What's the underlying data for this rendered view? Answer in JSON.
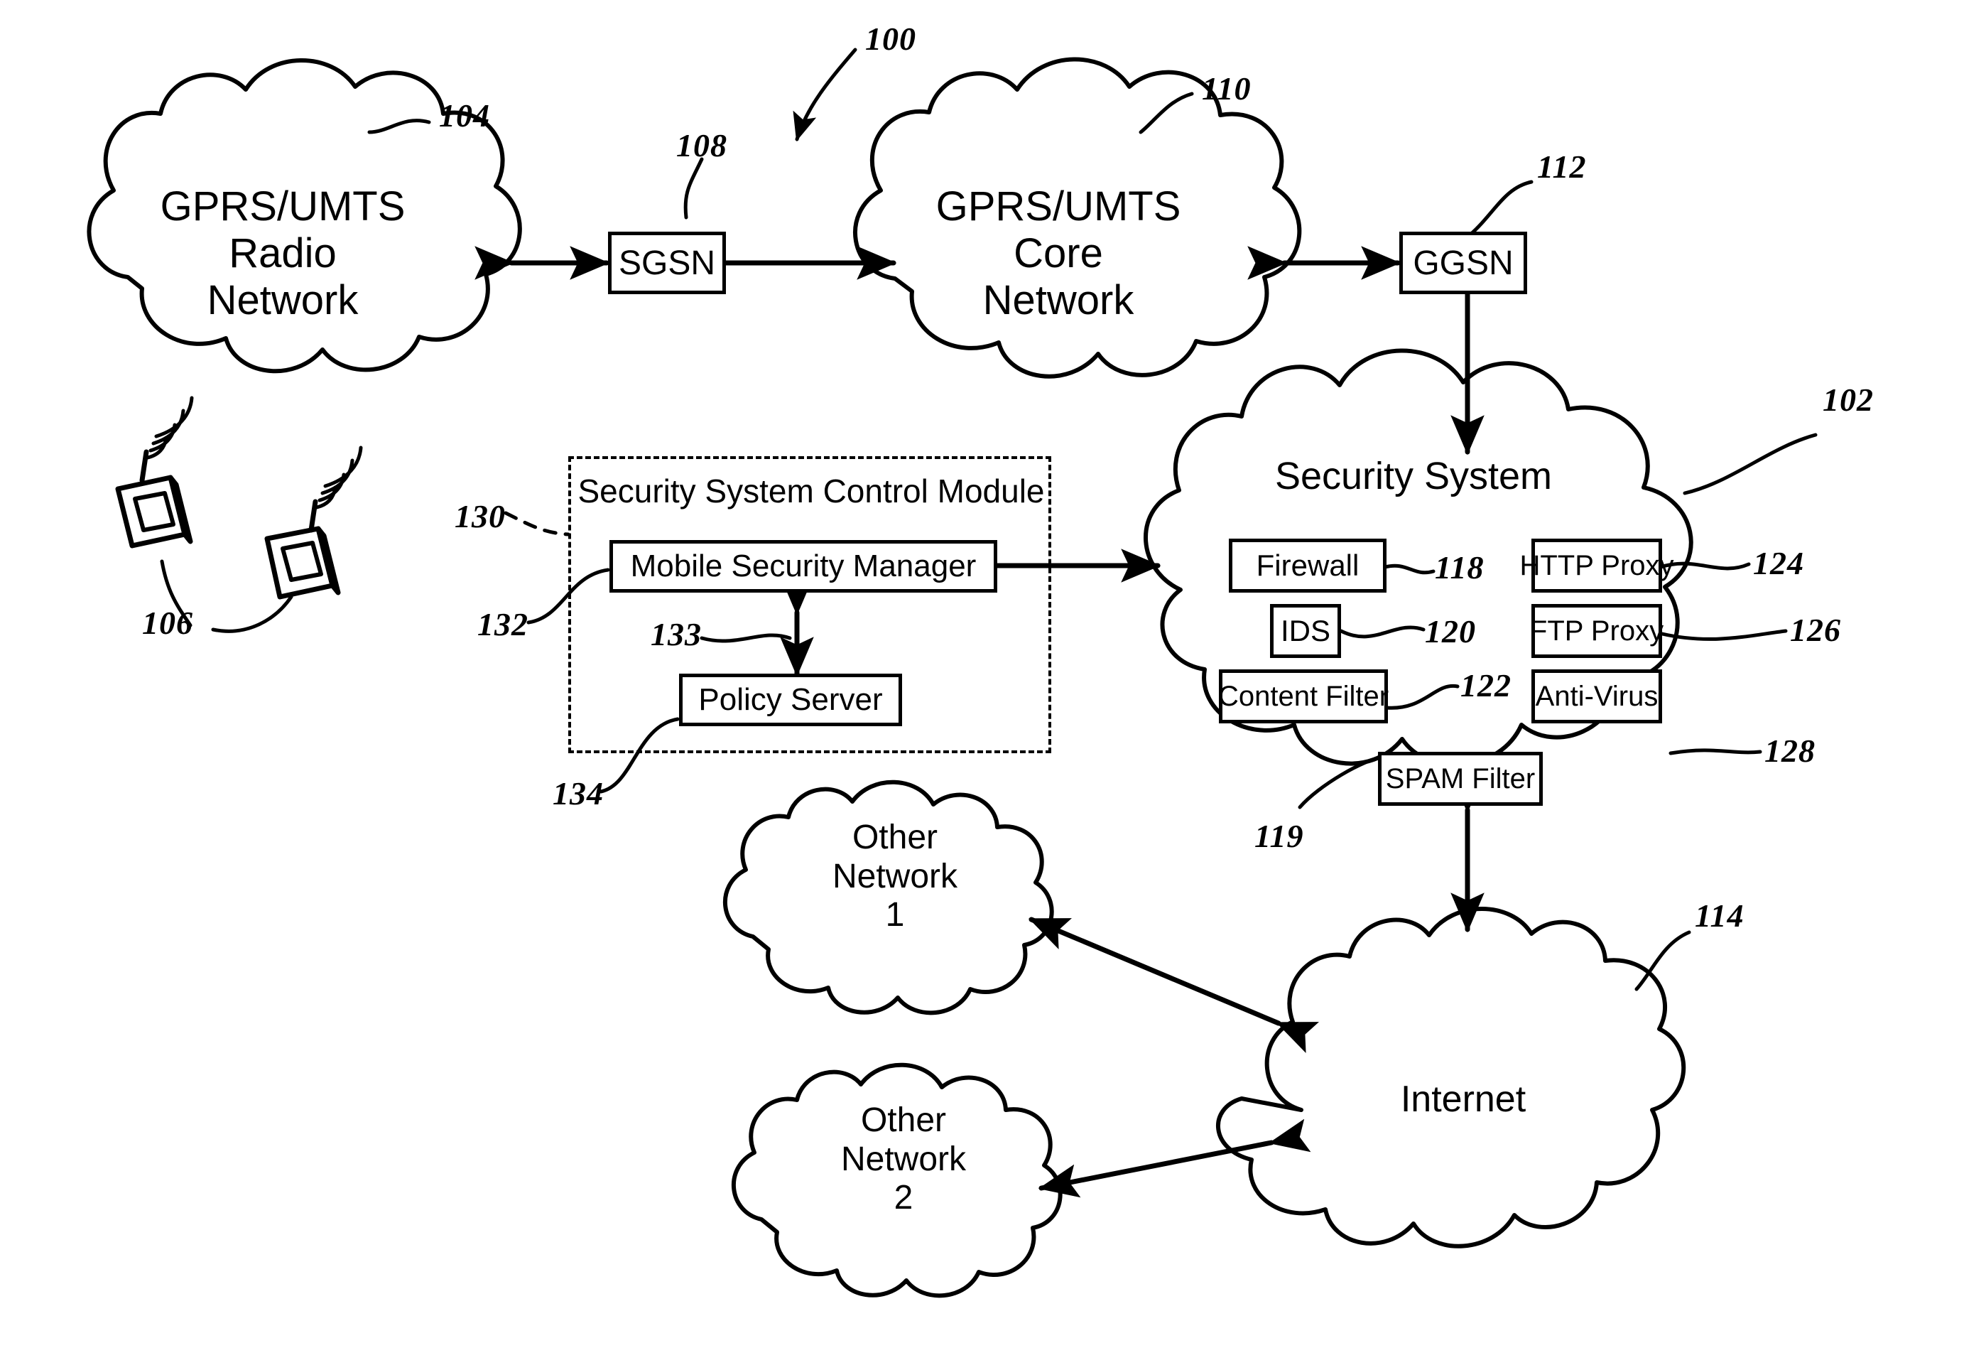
{
  "figure": {
    "system_ref": "100"
  },
  "clouds": [
    {
      "id": "radio-network",
      "label": "GPRS/UMTS\nRadio\nNetwork",
      "ref": "104"
    },
    {
      "id": "core-network",
      "label": "GPRS/UMTS\nCore\nNetwork",
      "ref": "110"
    },
    {
      "id": "security-system",
      "label": "Security System",
      "ref": "102"
    },
    {
      "id": "other-network-1",
      "label": "Other\nNetwork\n1",
      "ref": ""
    },
    {
      "id": "other-network-2",
      "label": "Other\nNetwork\n2",
      "ref": ""
    },
    {
      "id": "internet",
      "label": "Internet",
      "ref": "114"
    }
  ],
  "nodes": [
    {
      "id": "sgsn",
      "label": "SGSN",
      "ref": "108"
    },
    {
      "id": "ggsn",
      "label": "GGSN",
      "ref": "112"
    }
  ],
  "control_module": {
    "title": "Security System Control Module",
    "ref": "130",
    "blocks": [
      {
        "id": "mobile-security-manager",
        "label": "Mobile Security Manager",
        "ref": "132"
      },
      {
        "id": "policy-server",
        "label": "Policy Server",
        "ref": "134"
      }
    ],
    "link_ref": "133"
  },
  "security_components": [
    {
      "id": "firewall",
      "label": "Firewall",
      "ref": "118"
    },
    {
      "id": "ids",
      "label": "IDS",
      "ref": "120"
    },
    {
      "id": "content-filter",
      "label": "Content Filter",
      "ref": "122"
    },
    {
      "id": "http-proxy",
      "label": "HTTP Proxy",
      "ref": "124"
    },
    {
      "id": "ftp-proxy",
      "label": "FTP Proxy",
      "ref": "126"
    },
    {
      "id": "anti-virus",
      "label": "Anti-Virus",
      "ref": "128"
    },
    {
      "id": "spam-filter",
      "label": "SPAM Filter",
      "ref": "119"
    }
  ],
  "mobile_devices": {
    "ref": "106"
  }
}
